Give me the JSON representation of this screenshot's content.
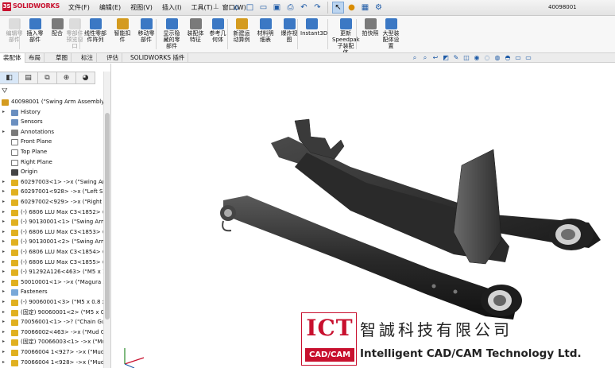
{
  "app": {
    "logo_text": "SOLIDWORKS",
    "document_title": "40098001",
    "brand_red": "#c8102e"
  },
  "menu": [
    "文件(F)",
    "编辑(E)",
    "视图(V)",
    "插入(I)",
    "工具(T)",
    "窗口(W)"
  ],
  "quick_access": [
    "home-icon",
    "new-icon",
    "open-icon",
    "save-icon",
    "print-icon",
    "undo-icon",
    "redo-icon",
    "select-icon",
    "traffic-light-icon",
    "rebuild-icon",
    "options-icon"
  ],
  "ribbon": [
    {
      "label": "编辑零\n部件",
      "dim": true
    },
    {
      "label": "插入零\n部件",
      "dim": false
    },
    {
      "label": "配合",
      "dim": false
    },
    {
      "label": "零部件\n预览窗\n口",
      "dim": true
    },
    {
      "label": "线性零部\n件阵列",
      "dim": false
    },
    {
      "label": "智能扣\n件",
      "dim": false
    },
    {
      "label": "移动零\n部件",
      "dim": false
    },
    {
      "label": "显示隐\n藏的零\n部件",
      "dim": false
    },
    {
      "label": "装配体\n特征",
      "dim": false
    },
    {
      "label": "参考几\n何体",
      "dim": false
    },
    {
      "label": "新建运\n动算例",
      "dim": false
    },
    {
      "label": "材料明\n细表",
      "dim": false
    },
    {
      "label": "爆炸视\n图",
      "dim": false
    },
    {
      "label": "Instant3D",
      "dim": false
    },
    {
      "label": "更新\nSpeedpak\n子装配\n体",
      "dim": false
    },
    {
      "label": "拍快照",
      "dim": false
    },
    {
      "label": "大型装\n配体设\n置",
      "dim": false
    }
  ],
  "tabs": [
    "装配体",
    "布局",
    "草图",
    "标注",
    "评估",
    "SOLIDWORKS 插件"
  ],
  "active_tab": 0,
  "panel_tabs": [
    "feature-manager-icon",
    "property-manager-icon",
    "configuration-manager-icon",
    "dimxpert-icon",
    "display-manager-icon"
  ],
  "tree": [
    {
      "text": "40098001 (\"Swing Arm Assembly\"",
      "icon": "assembly",
      "indent": 0,
      "exp": false
    },
    {
      "text": "History",
      "icon": "history",
      "indent": 1,
      "exp": true
    },
    {
      "text": "Sensors",
      "icon": "sensor",
      "indent": 1,
      "exp": false
    },
    {
      "text": "Annotations",
      "icon": "annotation",
      "indent": 1,
      "exp": true
    },
    {
      "text": "Front Plane",
      "icon": "plane",
      "indent": 1,
      "exp": false
    },
    {
      "text": "Top Plane",
      "icon": "plane",
      "indent": 1,
      "exp": false
    },
    {
      "text": "Right Plane",
      "icon": "plane",
      "indent": 1,
      "exp": false
    },
    {
      "text": "Origin",
      "icon": "origin",
      "indent": 1,
      "exp": false
    },
    {
      "text": "60297003<1> ->x (\"Swing Arm",
      "icon": "part",
      "indent": 1,
      "exp": true
    },
    {
      "text": "60297001<928> ->x (\"Left Sid",
      "icon": "part",
      "indent": 1,
      "exp": true
    },
    {
      "text": "60297002<929> ->x (\"Right S",
      "icon": "part",
      "indent": 1,
      "exp": true
    },
    {
      "text": "(-) 6806 LLU Max C3<1852> (",
      "icon": "part",
      "indent": 1,
      "exp": true
    },
    {
      "text": "(-) 90130001<1> (\"Swing Arm",
      "icon": "part",
      "indent": 1,
      "exp": true
    },
    {
      "text": "(-) 6806 LLU Max C3<1853> (",
      "icon": "part",
      "indent": 1,
      "exp": true
    },
    {
      "text": "(-) 90130001<2> (\"Swing Arm",
      "icon": "part",
      "indent": 1,
      "exp": true
    },
    {
      "text": "(-) 6806 LLU Max C3<1854> (",
      "icon": "part",
      "indent": 1,
      "exp": true
    },
    {
      "text": "(-) 6806 LLU Max C3<1855> (",
      "icon": "part",
      "indent": 1,
      "exp": true
    },
    {
      "text": "(-) 91292A126<463> (\"M5 x 1",
      "icon": "part",
      "indent": 1,
      "exp": true
    },
    {
      "text": "50010001<1> ->x (\"Magura 2",
      "icon": "part",
      "indent": 1,
      "exp": true
    },
    {
      "text": "Fasteners",
      "icon": "folder",
      "indent": 1,
      "exp": true
    },
    {
      "text": "(-) 90060001<3> (\"M5 x 0.8 x",
      "icon": "part",
      "indent": 1,
      "exp": true
    },
    {
      "text": "(固定) 90060001<2> (\"M5 x 0.",
      "icon": "part",
      "indent": 1,
      "exp": true
    },
    {
      "text": "70056001<1> ->? (\"Chain Gu",
      "icon": "part",
      "indent": 1,
      "exp": true
    },
    {
      "text": "70066002<463> ->x (\"Mud G",
      "icon": "part",
      "indent": 1,
      "exp": true
    },
    {
      "text": "(固定) 70066003<1> ->x (\"Mu",
      "icon": "part",
      "indent": 1,
      "exp": true
    },
    {
      "text": "70066004 1<927> ->x (\"Mud",
      "icon": "part",
      "indent": 1,
      "exp": true
    },
    {
      "text": "70066004 1<928> ->x (\"Mud",
      "icon": "part",
      "indent": 1,
      "exp": true
    }
  ],
  "view_tools": [
    "zoom-fit-icon",
    "zoom-area-icon",
    "previous-view-icon",
    "section-view-icon",
    "dynamic-annotation-icon",
    "view-orientation-icon",
    "display-style-icon",
    "hide-show-icon",
    "edit-appearance-icon",
    "scene-icon",
    "view-settings-icon",
    "monitor-icon"
  ],
  "watermark": {
    "ict": "ICT",
    "cadcam": "CAD/CAM",
    "chinese": "智誠科技有限公司",
    "english": "Intelligent CAD/CAM Technology Ltd."
  }
}
